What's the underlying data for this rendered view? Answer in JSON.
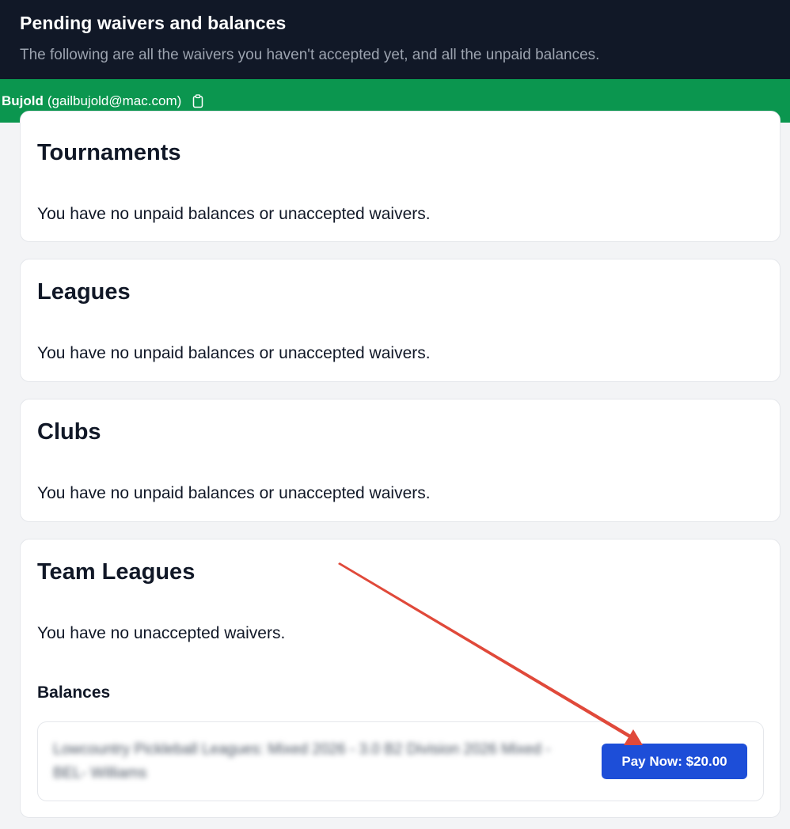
{
  "header": {
    "title": "Pending waivers and balances",
    "subtitle": "The following are all the waivers you haven't accepted yet, and all the unpaid balances."
  },
  "user": {
    "name": "Bujold",
    "email": "(gailbujold@mac.com)",
    "copy_icon": "clipboard-icon"
  },
  "sections": [
    {
      "title": "Tournaments",
      "message": "You have no unpaid balances or unaccepted waivers."
    },
    {
      "title": "Leagues",
      "message": "You have no unpaid balances or unaccepted waivers."
    },
    {
      "title": "Clubs",
      "message": "You have no unpaid balances or unaccepted waivers."
    },
    {
      "title": "Team Leagues",
      "message": "You have no unaccepted waivers."
    }
  ],
  "balances": {
    "heading": "Balances",
    "items": [
      {
        "description": "Lowcountry Pickleball Leagues: Mixed 2026 - 3.0 B2 Division 2026 Mixed - BEL- Williams",
        "button_label": "Pay Now: $20.00"
      }
    ]
  },
  "colors": {
    "header_bg": "#111827",
    "user_bar_bg": "#0b964f",
    "pay_button_bg": "#1d4ed8",
    "annotation_arrow": "#e0493a"
  }
}
